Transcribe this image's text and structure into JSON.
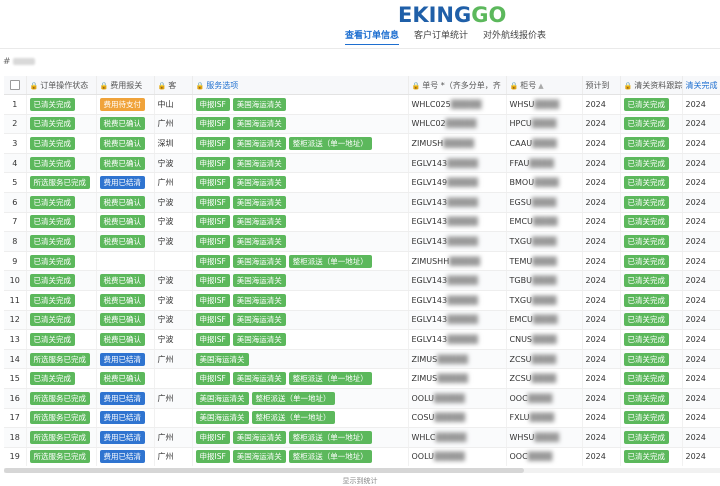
{
  "header": {
    "logo_text_1": "EKING",
    "logo_text_2": "GO"
  },
  "nav": {
    "items": [
      {
        "label": "查看订单信息",
        "active": true
      },
      {
        "label": "客户订单统计",
        "active": false
      },
      {
        "label": "对外航线报价表",
        "active": false
      }
    ]
  },
  "subline": {
    "prefix": "#"
  },
  "table": {
    "headers": {
      "order_status": "订单操作状态",
      "fee_status": "费用报关",
      "customer": "客",
      "service": "服务选项",
      "bill_no": "单号 *（齐多分单，齐",
      "container_no": "柜号",
      "eta": "预计到",
      "clearance_fee_status": "清关资料跟踪",
      "clearance_extra": "清关完成"
    },
    "rows": [
      {
        "idx": "1",
        "status": "已清关完成",
        "fee": "费用待支付",
        "fee_color": "orange",
        "cust": "中山",
        "services": [
          "申报ISF",
          "美国海运清关"
        ],
        "bill": "WHLC025",
        "cont": "WHSU",
        "eta": "2024",
        "clr": "已清关完成",
        "extra": "2024"
      },
      {
        "idx": "2",
        "status": "已清关完成",
        "fee": "税费已确认",
        "fee_color": "green",
        "cust": "广州",
        "services": [
          "申报ISF",
          "美国海运清关"
        ],
        "bill": "WHLC02",
        "cont": "HPCU",
        "eta": "2024",
        "clr": "已清关完成",
        "extra": "2024"
      },
      {
        "idx": "3",
        "status": "已清关完成",
        "fee": "税费已确认",
        "fee_color": "green",
        "cust": "深圳",
        "services": [
          "申报ISF",
          "美国海运清关",
          "整柜派送（单一地址）"
        ],
        "bill": "ZIMUSH",
        "cont": "CAAU",
        "eta": "2024",
        "clr": "已清关完成",
        "extra": "2024"
      },
      {
        "idx": "4",
        "status": "已清关完成",
        "fee": "税费已确认",
        "fee_color": "green",
        "cust": "宁波",
        "services": [
          "申报ISF",
          "美国海运清关"
        ],
        "bill": "EGLV143",
        "cont": "FFAU",
        "eta": "2024",
        "clr": "已清关完成",
        "extra": "2024"
      },
      {
        "idx": "5",
        "status": "所选服务已完成",
        "fee": "费用已结清",
        "fee_color": "blue",
        "cust": "广州",
        "services": [
          "申报ISF",
          "美国海运清关"
        ],
        "bill": "EGLV149",
        "cont": "BMOU",
        "eta": "2024",
        "clr": "已清关完成",
        "extra": "2024"
      },
      {
        "idx": "6",
        "status": "已清关完成",
        "fee": "税费已确认",
        "fee_color": "green",
        "cust": "宁波",
        "services": [
          "申报ISF",
          "美国海运清关"
        ],
        "bill": "EGLV143",
        "cont": "EGSU",
        "eta": "2024",
        "clr": "已清关完成",
        "extra": "2024"
      },
      {
        "idx": "7",
        "status": "已清关完成",
        "fee": "税费已确认",
        "fee_color": "green",
        "cust": "宁波",
        "services": [
          "申报ISF",
          "美国海运清关"
        ],
        "bill": "EGLV143",
        "cont": "EMCU",
        "eta": "2024",
        "clr": "已清关完成",
        "extra": "2024"
      },
      {
        "idx": "8",
        "status": "已清关完成",
        "fee": "税费已确认",
        "fee_color": "green",
        "cust": "宁波",
        "services": [
          "申报ISF",
          "美国海运清关"
        ],
        "bill": "EGLV143",
        "cont": "TXGU",
        "eta": "2024",
        "clr": "已清关完成",
        "extra": "2024"
      },
      {
        "idx": "9",
        "status": "已清关完成",
        "fee": "",
        "fee_color": "green",
        "cust": "",
        "services": [
          "申报ISF",
          "美国海运清关",
          "整柜派送（单一地址）"
        ],
        "bill": "ZIMUSHH",
        "cont": "TEMU",
        "eta": "2024",
        "clr": "已清关完成",
        "extra": "2024"
      },
      {
        "idx": "10",
        "status": "已清关完成",
        "fee": "税费已确认",
        "fee_color": "green",
        "cust": "宁波",
        "services": [
          "申报ISF",
          "美国海运清关"
        ],
        "bill": "EGLV143",
        "cont": "TGBU",
        "eta": "2024",
        "clr": "已清关完成",
        "extra": "2024"
      },
      {
        "idx": "11",
        "status": "已清关完成",
        "fee": "税费已确认",
        "fee_color": "green",
        "cust": "宁波",
        "services": [
          "申报ISF",
          "美国海运清关"
        ],
        "bill": "EGLV143",
        "cont": "TXGU",
        "eta": "2024",
        "clr": "已清关完成",
        "extra": "2024"
      },
      {
        "idx": "12",
        "status": "已清关完成",
        "fee": "税费已确认",
        "fee_color": "green",
        "cust": "宁波",
        "services": [
          "申报ISF",
          "美国海运清关"
        ],
        "bill": "EGLV143",
        "cont": "EMCU",
        "eta": "2024",
        "clr": "已清关完成",
        "extra": "2024"
      },
      {
        "idx": "13",
        "status": "已清关完成",
        "fee": "税费已确认",
        "fee_color": "green",
        "cust": "宁波",
        "services": [
          "申报ISF",
          "美国海运清关"
        ],
        "bill": "EGLV143",
        "cont": "CNUS",
        "eta": "2024",
        "clr": "已清关完成",
        "extra": "2024"
      },
      {
        "idx": "14",
        "status": "所选服务已完成",
        "fee": "费用已结清",
        "fee_color": "blue",
        "cust": "广州",
        "services": [
          "美国海运清关"
        ],
        "bill": "ZIMUS",
        "cont": "ZCSU",
        "eta": "2024",
        "clr": "已清关完成",
        "extra": "2024"
      },
      {
        "idx": "15",
        "status": "已清关完成",
        "fee": "税费已确认",
        "fee_color": "green",
        "cust": "",
        "services": [
          "申报ISF",
          "美国海运清关",
          "整柜派送（单一地址）"
        ],
        "bill": "ZIMUS",
        "cont": "ZCSU",
        "eta": "2024",
        "clr": "已清关完成",
        "extra": "2024"
      },
      {
        "idx": "16",
        "status": "所选服务已完成",
        "fee": "费用已结清",
        "fee_color": "blue",
        "cust": "广州",
        "services": [
          "美国海运清关",
          "整柜派送（单一地址）"
        ],
        "bill": "OOLU",
        "cont": "OOC",
        "eta": "2024",
        "clr": "已清关完成",
        "extra": "2024"
      },
      {
        "idx": "17",
        "status": "所选服务已完成",
        "fee": "费用已结清",
        "fee_color": "blue",
        "cust": "",
        "services": [
          "美国海运清关",
          "整柜派送（单一地址）"
        ],
        "bill": "COSU",
        "cont": "FXLU",
        "eta": "2024",
        "clr": "已清关完成",
        "extra": "2024"
      },
      {
        "idx": "18",
        "status": "所选服务已完成",
        "fee": "费用已结清",
        "fee_color": "blue",
        "cust": "广州",
        "services": [
          "申报ISF",
          "美国海运清关",
          "整柜派送（单一地址）"
        ],
        "bill": "WHLC",
        "cont": "WHSU",
        "eta": "2024",
        "clr": "已清关完成",
        "extra": "2024"
      },
      {
        "idx": "19",
        "status": "所选服务已完成",
        "fee": "费用已结清",
        "fee_color": "blue",
        "cust": "广州",
        "services": [
          "申报ISF",
          "美国海运清关",
          "整柜派送（单一地址）"
        ],
        "bill": "OOLU",
        "cont": "OOC",
        "eta": "2024",
        "clr": "已清关完成",
        "extra": "2024"
      },
      {
        "idx": "20",
        "status": "所选服务已完成",
        "fee": "费用已结清",
        "fee_color": "blue",
        "cust": "",
        "services": [
          "申报ISF",
          "美国海运清关"
        ],
        "bill": "OOLU",
        "cont": "OOC",
        "eta": "2024",
        "clr": "已清关完成",
        "extra": "2024"
      }
    ]
  },
  "footer": {
    "label": "显示到统计"
  }
}
